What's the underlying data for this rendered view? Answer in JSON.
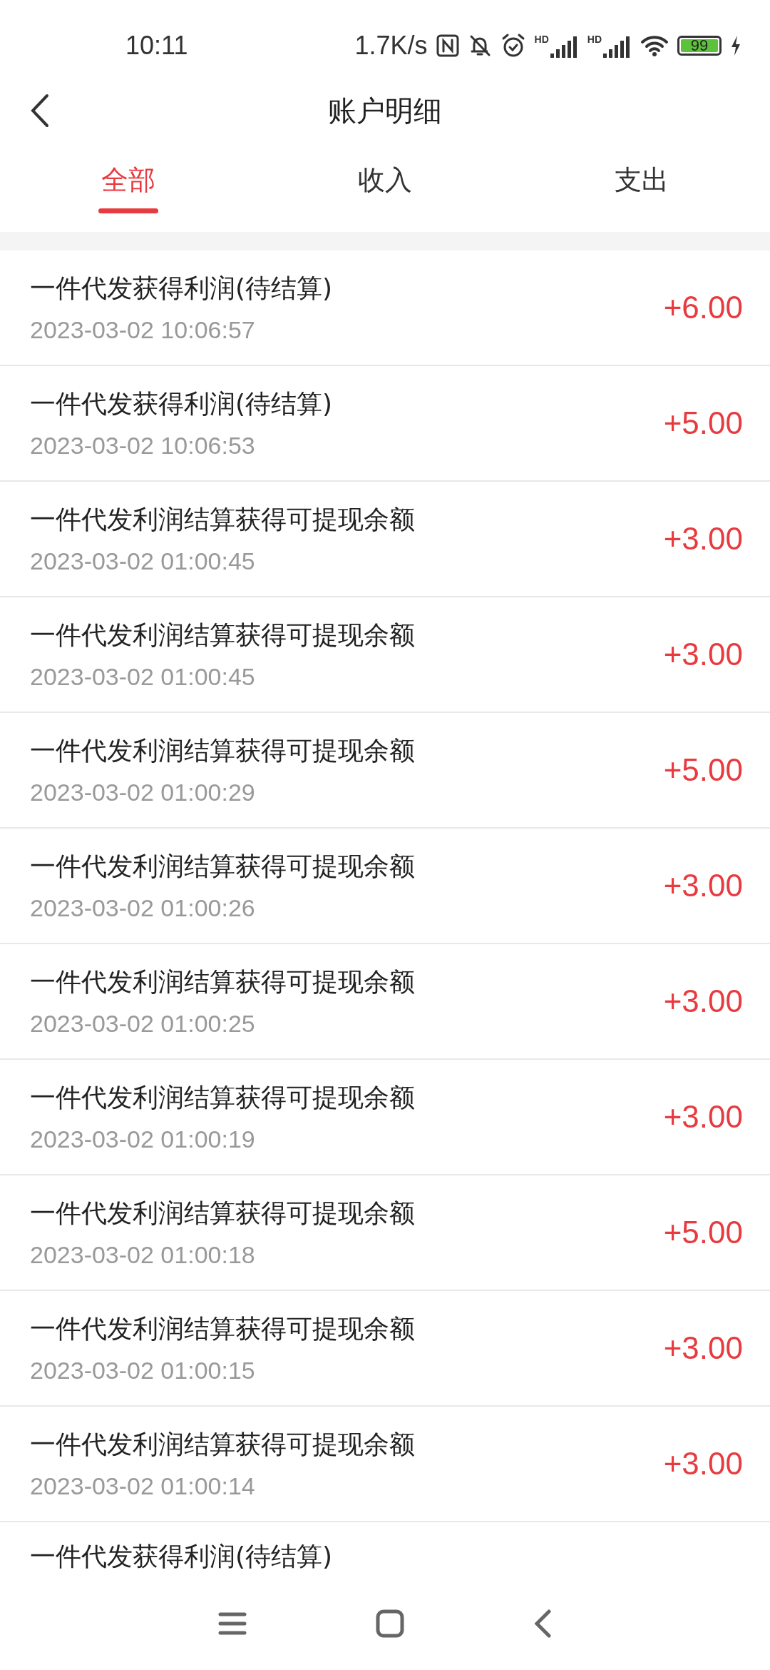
{
  "status_bar": {
    "time": "10:11",
    "net_speed": "1.7K/s",
    "signal_label_1": "HD",
    "signal_label_2": "HD",
    "battery": "99"
  },
  "header": {
    "title": "账户明细"
  },
  "tabs": [
    {
      "label": "全部",
      "selected": true
    },
    {
      "label": "收入",
      "selected": false
    },
    {
      "label": "支出",
      "selected": false
    }
  ],
  "records": [
    {
      "title": "一件代发获得利润(待结算)",
      "time": "2023-03-02 10:06:57",
      "amount": "+6.00"
    },
    {
      "title": "一件代发获得利润(待结算)",
      "time": "2023-03-02 10:06:53",
      "amount": "+5.00"
    },
    {
      "title": "一件代发利润结算获得可提现余额",
      "time": "2023-03-02 01:00:45",
      "amount": "+3.00"
    },
    {
      "title": "一件代发利润结算获得可提现余额",
      "time": "2023-03-02 01:00:45",
      "amount": "+3.00"
    },
    {
      "title": "一件代发利润结算获得可提现余额",
      "time": "2023-03-02 01:00:29",
      "amount": "+5.00"
    },
    {
      "title": "一件代发利润结算获得可提现余额",
      "time": "2023-03-02 01:00:26",
      "amount": "+3.00"
    },
    {
      "title": "一件代发利润结算获得可提现余额",
      "time": "2023-03-02 01:00:25",
      "amount": "+3.00"
    },
    {
      "title": "一件代发利润结算获得可提现余额",
      "time": "2023-03-02 01:00:19",
      "amount": "+3.00"
    },
    {
      "title": "一件代发利润结算获得可提现余额",
      "time": "2023-03-02 01:00:18",
      "amount": "+5.00"
    },
    {
      "title": "一件代发利润结算获得可提现余额",
      "time": "2023-03-02 01:00:15",
      "amount": "+3.00"
    },
    {
      "title": "一件代发利润结算获得可提现余额",
      "time": "2023-03-02 01:00:14",
      "amount": "+3.00"
    },
    {
      "title": "一件代发获得利润(待结算)"
    }
  ]
}
